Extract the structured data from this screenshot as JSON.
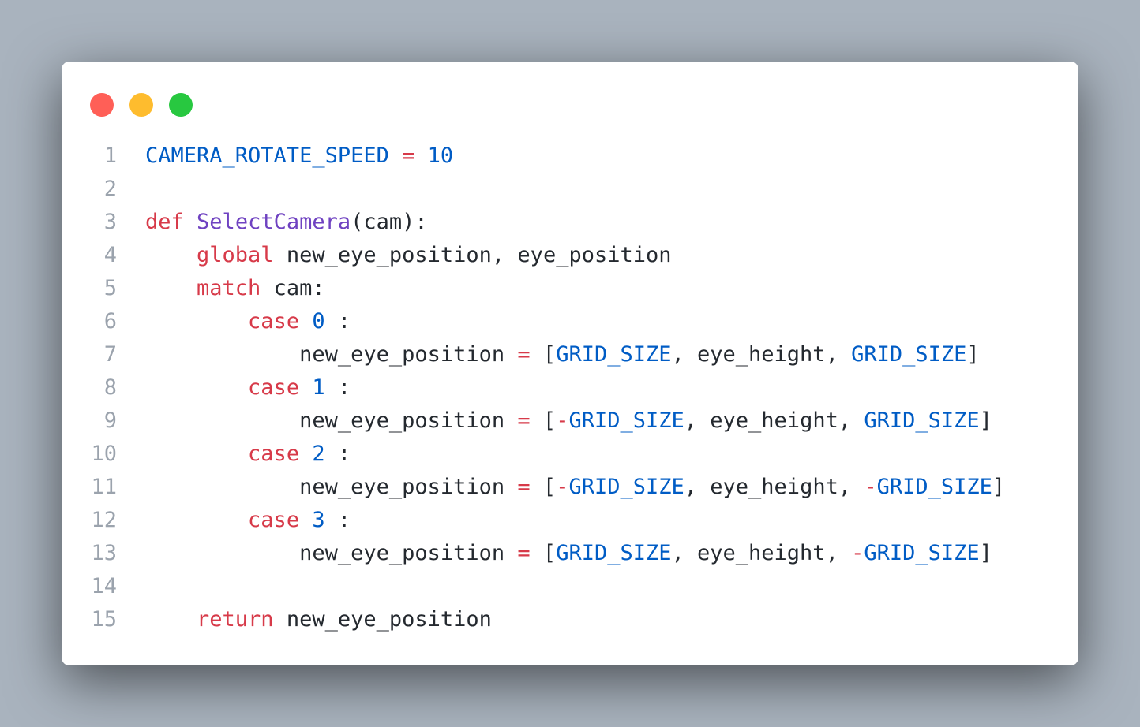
{
  "window": {
    "controls": [
      {
        "name": "close",
        "color": "#ff5f57"
      },
      {
        "name": "minimize",
        "color": "#febc2e"
      },
      {
        "name": "zoom",
        "color": "#28c840"
      }
    ]
  },
  "code": {
    "language": "python",
    "lines": [
      {
        "number": "1",
        "tokens": [
          [
            "const",
            "CAMERA_ROTATE_SPEED"
          ],
          [
            "plain",
            " "
          ],
          [
            "op",
            "="
          ],
          [
            "plain",
            " "
          ],
          [
            "num",
            "10"
          ]
        ]
      },
      {
        "number": "2",
        "tokens": []
      },
      {
        "number": "3",
        "tokens": [
          [
            "kw",
            "def"
          ],
          [
            "plain",
            " "
          ],
          [
            "fn",
            "SelectCamera"
          ],
          [
            "plain",
            "(cam):"
          ]
        ]
      },
      {
        "number": "4",
        "tokens": [
          [
            "plain",
            "    "
          ],
          [
            "kw",
            "global"
          ],
          [
            "plain",
            " new_eye_position, eye_position"
          ]
        ]
      },
      {
        "number": "5",
        "tokens": [
          [
            "plain",
            "    "
          ],
          [
            "kw",
            "match"
          ],
          [
            "plain",
            " cam:"
          ]
        ]
      },
      {
        "number": "6",
        "tokens": [
          [
            "plain",
            "        "
          ],
          [
            "kw",
            "case"
          ],
          [
            "plain",
            " "
          ],
          [
            "num",
            "0"
          ],
          [
            "plain",
            " :"
          ]
        ]
      },
      {
        "number": "7",
        "tokens": [
          [
            "plain",
            "            new_eye_position "
          ],
          [
            "op",
            "="
          ],
          [
            "plain",
            " ["
          ],
          [
            "const",
            "GRID_SIZE"
          ],
          [
            "plain",
            ", eye_height, "
          ],
          [
            "const",
            "GRID_SIZE"
          ],
          [
            "plain",
            "]"
          ]
        ]
      },
      {
        "number": "8",
        "tokens": [
          [
            "plain",
            "        "
          ],
          [
            "kw",
            "case"
          ],
          [
            "plain",
            " "
          ],
          [
            "num",
            "1"
          ],
          [
            "plain",
            " :"
          ]
        ]
      },
      {
        "number": "9",
        "tokens": [
          [
            "plain",
            "            new_eye_position "
          ],
          [
            "op",
            "="
          ],
          [
            "plain",
            " ["
          ],
          [
            "op",
            "-"
          ],
          [
            "const",
            "GRID_SIZE"
          ],
          [
            "plain",
            ", eye_height, "
          ],
          [
            "const",
            "GRID_SIZE"
          ],
          [
            "plain",
            "]"
          ]
        ]
      },
      {
        "number": "10",
        "tokens": [
          [
            "plain",
            "        "
          ],
          [
            "kw",
            "case"
          ],
          [
            "plain",
            " "
          ],
          [
            "num",
            "2"
          ],
          [
            "plain",
            " :"
          ]
        ]
      },
      {
        "number": "11",
        "tokens": [
          [
            "plain",
            "            new_eye_position "
          ],
          [
            "op",
            "="
          ],
          [
            "plain",
            " ["
          ],
          [
            "op",
            "-"
          ],
          [
            "const",
            "GRID_SIZE"
          ],
          [
            "plain",
            ", eye_height, "
          ],
          [
            "op",
            "-"
          ],
          [
            "const",
            "GRID_SIZE"
          ],
          [
            "plain",
            "]"
          ]
        ]
      },
      {
        "number": "12",
        "tokens": [
          [
            "plain",
            "        "
          ],
          [
            "kw",
            "case"
          ],
          [
            "plain",
            " "
          ],
          [
            "num",
            "3"
          ],
          [
            "plain",
            " :"
          ]
        ]
      },
      {
        "number": "13",
        "tokens": [
          [
            "plain",
            "            new_eye_position "
          ],
          [
            "op",
            "="
          ],
          [
            "plain",
            " ["
          ],
          [
            "const",
            "GRID_SIZE"
          ],
          [
            "plain",
            ", eye_height, "
          ],
          [
            "op",
            "-"
          ],
          [
            "const",
            "GRID_SIZE"
          ],
          [
            "plain",
            "]"
          ]
        ]
      },
      {
        "number": "14",
        "tokens": []
      },
      {
        "number": "15",
        "tokens": [
          [
            "plain",
            "    "
          ],
          [
            "kw",
            "return"
          ],
          [
            "plain",
            " new_eye_position"
          ]
        ]
      }
    ]
  },
  "colors": {
    "background": "#a9b3be",
    "window": "#ffffff",
    "keyword": "#d73a49",
    "constant": "#005cc5",
    "function": "#6f42c1",
    "text": "#24292f",
    "line_number": "#9ba3ad"
  }
}
